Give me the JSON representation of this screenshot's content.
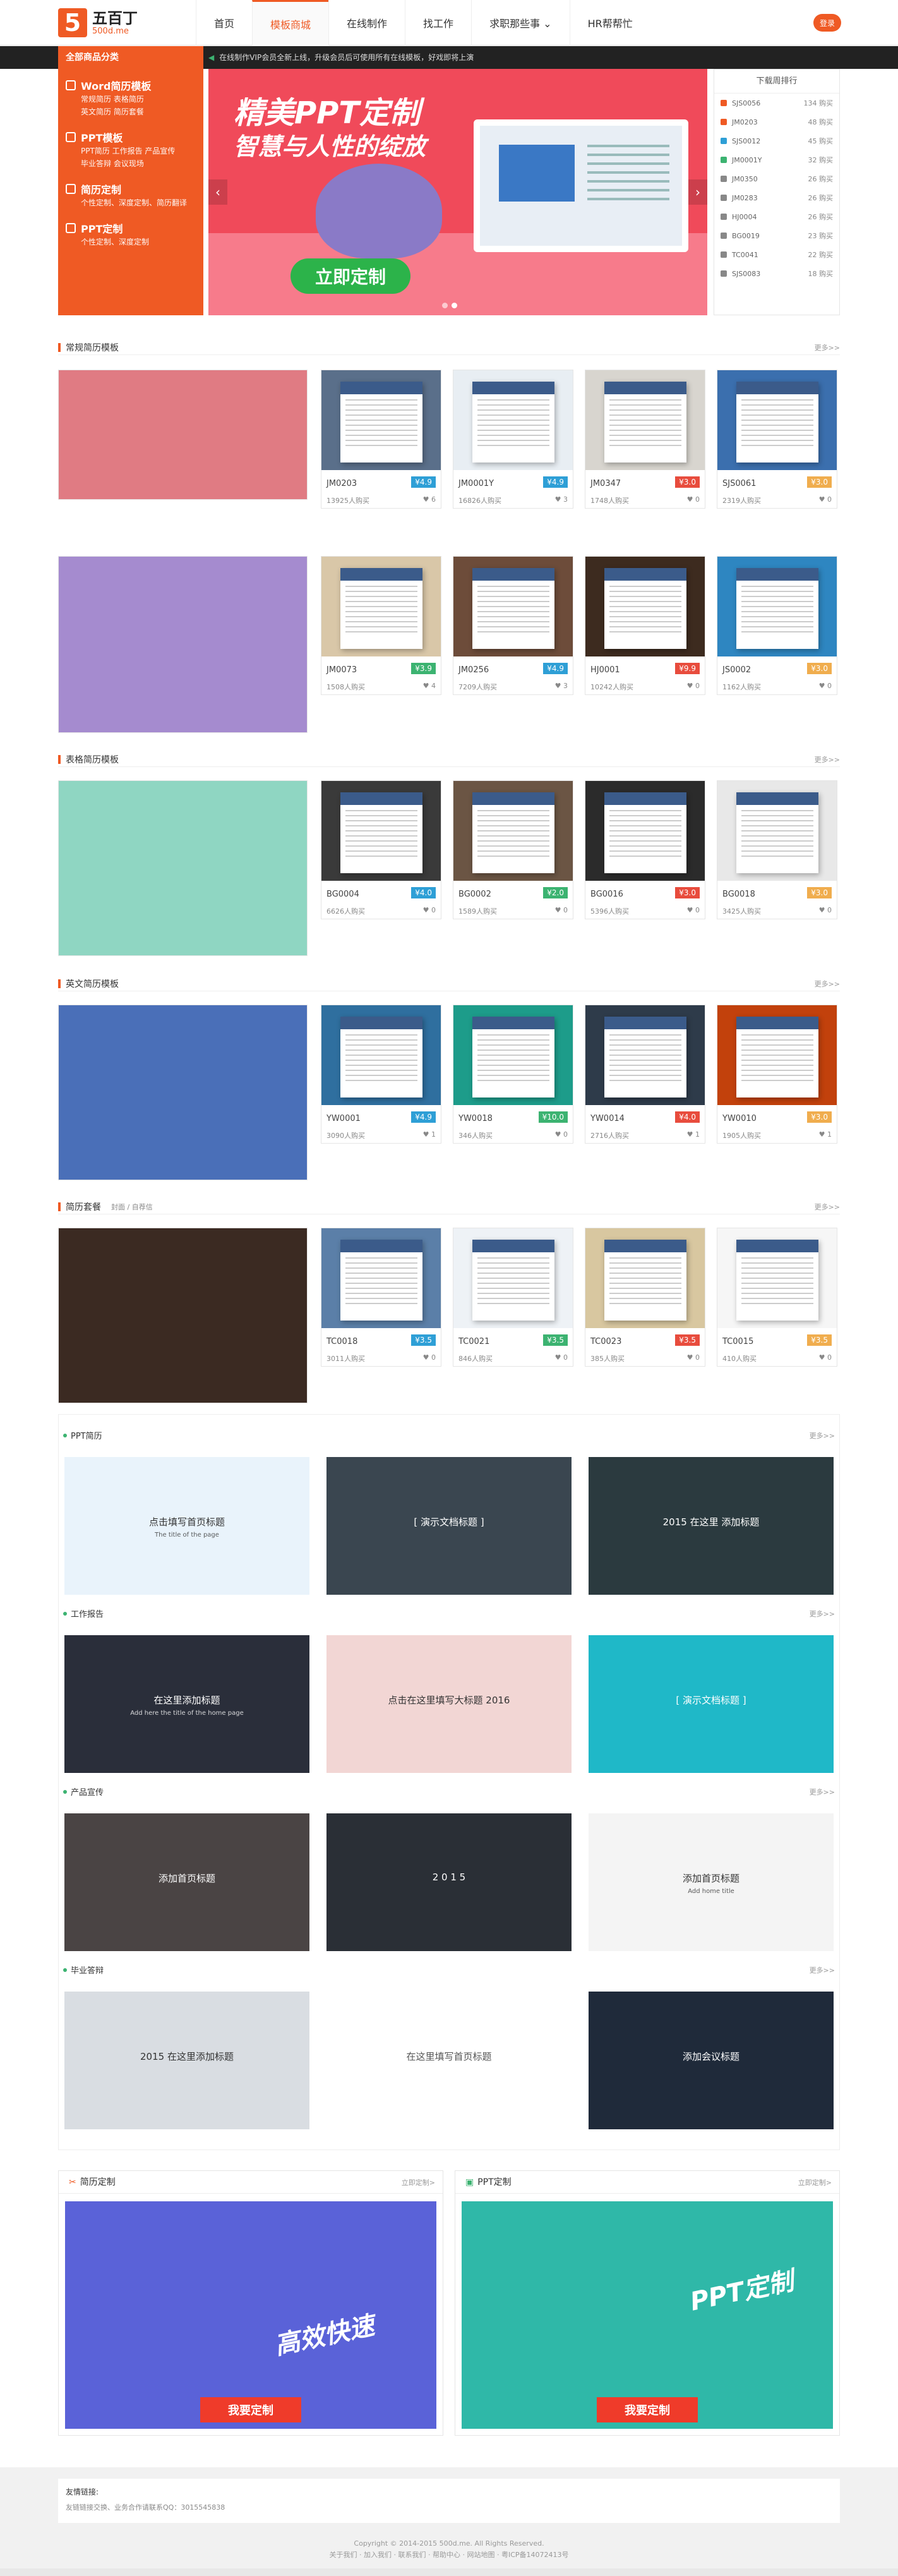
{
  "header": {
    "logo_main": "五百丁",
    "logo_sub": "500d.me",
    "nav": [
      {
        "label": "首页"
      },
      {
        "label": "模板商城"
      },
      {
        "label": "在线制作"
      },
      {
        "label": "找工作"
      },
      {
        "label": "求职那些事 ⌄"
      },
      {
        "label": "HR帮帮忙"
      }
    ],
    "login": "登录"
  },
  "bar": {
    "title": "全部商品分类",
    "notice": "在线制作VIP会员全新上线，升级会员后可使用所有在线模板，好戏即将上演"
  },
  "categories": [
    {
      "title": "Word简历模板",
      "sub": [
        "常规简历 表格简历",
        "英文简历 简历套餐"
      ]
    },
    {
      "title": "PPT模板",
      "sub": [
        "PPT简历 工作报告 产品宣传",
        "毕业答辩 会议现场"
      ]
    },
    {
      "title": "简历定制",
      "sub": [
        "个性定制、深度定制、简历翻译"
      ]
    },
    {
      "title": "PPT定制",
      "sub": [
        "个性定制、深度定制"
      ]
    }
  ],
  "banner": {
    "line1": "精美PPT定制",
    "line2": "智慧与人性的绽放",
    "cta": "立即定制"
  },
  "rank": {
    "title": "下载周排行",
    "rows": [
      {
        "code": "SJS0056",
        "count": "134 购买",
        "color": "#ef5a24"
      },
      {
        "code": "JM0203",
        "count": "48 购买",
        "color": "#ef5a24"
      },
      {
        "code": "SJS0012",
        "count": "45 购买",
        "color": "#2e9fd6"
      },
      {
        "code": "JM0001Y",
        "count": "32 购买",
        "color": "#3cb371"
      },
      {
        "code": "JM0350",
        "count": "26 购买",
        "color": "#888"
      },
      {
        "code": "JM0283",
        "count": "26 购买",
        "color": "#888"
      },
      {
        "code": "HJ0004",
        "count": "26 购买",
        "color": "#888"
      },
      {
        "code": "BG0019",
        "count": "23 购买",
        "color": "#888"
      },
      {
        "code": "TC0041",
        "count": "22 购买",
        "color": "#888"
      },
      {
        "code": "SJS0083",
        "count": "18 购买",
        "color": "#888"
      }
    ]
  },
  "sections": {
    "normal": "常规简历模板",
    "table": "表格简历模板",
    "english": "英文简历模板",
    "package": "简历套餐",
    "package_tabs": "封面 / 自荐信",
    "more": "更多>>"
  },
  "cards": {
    "normal": [
      {
        "code": "JM0203",
        "price": "¥4.9",
        "buy": "13925人购买",
        "fav": "♥ 6",
        "color": "#2e9fd6"
      },
      {
        "code": "JM0001Y",
        "price": "¥4.9",
        "buy": "16826人购买",
        "fav": "♥ 3",
        "color": "#2e9fd6"
      },
      {
        "code": "JM0347",
        "price": "¥3.0",
        "buy": "1748人购买",
        "fav": "♥ 0",
        "color": "#e84c3d"
      },
      {
        "code": "SJS0061",
        "price": "¥3.0",
        "buy": "2319人购买",
        "fav": "♥ 0",
        "color": "#f0ad4e"
      },
      {
        "code": "JM0073",
        "price": "¥3.9",
        "buy": "1508人购买",
        "fav": "♥ 4",
        "color": "#3cb371"
      },
      {
        "code": "JM0256",
        "price": "¥4.9",
        "buy": "7209人购买",
        "fav": "♥ 3",
        "color": "#2e9fd6"
      },
      {
        "code": "HJ0001",
        "price": "¥9.9",
        "buy": "10242人购买",
        "fav": "♥ 0",
        "color": "#e84c3d"
      },
      {
        "code": "JS0002",
        "price": "¥3.0",
        "buy": "1162人购买",
        "fav": "♥ 0",
        "color": "#f0ad4e"
      }
    ],
    "table": [
      {
        "code": "BG0004",
        "price": "¥4.0",
        "buy": "6626人购买",
        "fav": "♥ 0",
        "color": "#2e9fd6"
      },
      {
        "code": "BG0002",
        "price": "¥2.0",
        "buy": "1589人购买",
        "fav": "♥ 0",
        "color": "#3cb371"
      },
      {
        "code": "BG0016",
        "price": "¥3.0",
        "buy": "5396人购买",
        "fav": "♥ 0",
        "color": "#e84c3d"
      },
      {
        "code": "BG0018",
        "price": "¥3.0",
        "buy": "3425人购买",
        "fav": "♥ 0",
        "color": "#f0ad4e"
      }
    ],
    "english": [
      {
        "code": "YW0001",
        "price": "¥4.9",
        "buy": "3090人购买",
        "fav": "♥ 1",
        "color": "#2e9fd6"
      },
      {
        "code": "YW0018",
        "price": "¥10.0",
        "buy": "346人购买",
        "fav": "♥ 0",
        "color": "#3cb371"
      },
      {
        "code": "YW0014",
        "price": "¥4.0",
        "buy": "2716人购买",
        "fav": "♥ 1",
        "color": "#e84c3d"
      },
      {
        "code": "YW0010",
        "price": "¥3.0",
        "buy": "1905人购买",
        "fav": "♥ 1",
        "color": "#f0ad4e"
      }
    ],
    "package": [
      {
        "code": "TC0018",
        "price": "¥3.5",
        "buy": "3011人购买",
        "fav": "♥ 0",
        "color": "#2e9fd6"
      },
      {
        "code": "TC0021",
        "price": "¥3.5",
        "buy": "846人购买",
        "fav": "♥ 0",
        "color": "#3cb371"
      },
      {
        "code": "TC0023",
        "price": "¥3.5",
        "buy": "385人购买",
        "fav": "♥ 0",
        "color": "#e84c3d"
      },
      {
        "code": "TC0015",
        "price": "¥3.5",
        "buy": "410人购买",
        "fav": "♥ 0",
        "color": "#f0ad4e"
      }
    ]
  },
  "ppt": {
    "cats": [
      "PPT简历",
      "工作报告",
      "产品宣传",
      "毕业答辩"
    ],
    "more": "更多>>",
    "slides": [
      [
        {
          "t": "点击填写首页标题",
          "s": "The title of the page"
        },
        {
          "t": "[ 演示文档标题 ]",
          "s": ""
        },
        {
          "t": "2015 在这里 添加标题",
          "s": ""
        }
      ],
      [
        {
          "t": "在这里添加标题",
          "s": "Add here the title of the home page"
        },
        {
          "t": "点击在这里填写大标题 2016",
          "s": ""
        },
        {
          "t": "[ 演示文档标题 ]",
          "s": ""
        }
      ],
      [
        {
          "t": "添加首页标题",
          "s": ""
        },
        {
          "t": "2 0 1 5",
          "s": ""
        },
        {
          "t": "添加首页标题",
          "s": "Add home title"
        }
      ],
      [
        {
          "t": "2015 在这里添加标题",
          "s": ""
        },
        {
          "t": "在这里填写首页标题",
          "s": ""
        },
        {
          "t": "添加会议标题",
          "s": ""
        }
      ]
    ]
  },
  "custom": {
    "resume_title": "简历定制",
    "ppt_title": "PPT定制",
    "more": "立即定制>",
    "resume_big": "高效快速",
    "ppt_big": "PPT定制",
    "btn": "我要定制"
  },
  "footer": {
    "links_title": "友情链接:",
    "links": "友链链接交换、业务合作请联系QQ：3015545838",
    "copy1": "Copyright © 2014-2015 500d.me. All Rights Reserved.",
    "copy2": "关于我们 · 加入我们 · 联系我们 · 帮助中心 · 网站地图 · 粤ICP备14072413号"
  }
}
